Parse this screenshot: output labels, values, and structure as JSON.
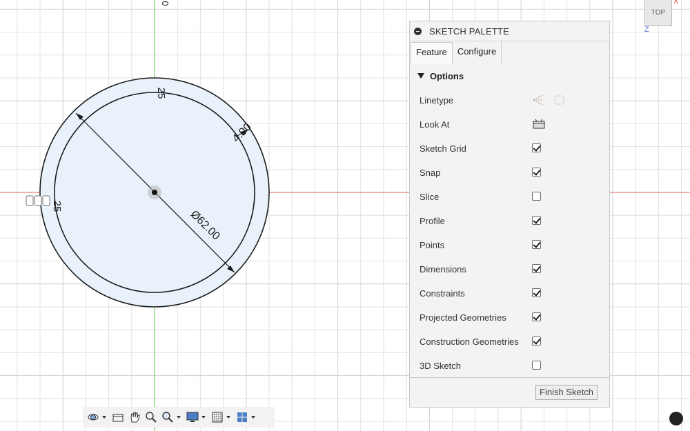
{
  "viewport": {
    "dim_radius": "25",
    "dim_offset": "4.00",
    "dim_diameter": "Ø62.00",
    "origin_label": "0"
  },
  "viewcube": {
    "face": "TOP",
    "axis_x": "X",
    "axis_z": "Z"
  },
  "palette": {
    "title": "SKETCH PALETTE",
    "tabs": [
      {
        "label": "Feature",
        "active": true
      },
      {
        "label": "Configure",
        "active": false
      }
    ],
    "section": "Options",
    "rows": [
      {
        "label": "Linetype",
        "control": "icons",
        "icons": [
          "construction-linetype-icon",
          "centerline-linetype-icon"
        ]
      },
      {
        "label": "Look At",
        "control": "icon",
        "icons": [
          "look-at-icon"
        ]
      },
      {
        "label": "Sketch Grid",
        "control": "checkbox",
        "checked": true
      },
      {
        "label": "Snap",
        "control": "checkbox",
        "checked": true
      },
      {
        "label": "Slice",
        "control": "checkbox",
        "checked": false
      },
      {
        "label": "Profile",
        "control": "checkbox",
        "checked": true
      },
      {
        "label": "Points",
        "control": "checkbox",
        "checked": true
      },
      {
        "label": "Dimensions",
        "control": "checkbox",
        "checked": true
      },
      {
        "label": "Constraints",
        "control": "checkbox",
        "checked": true
      },
      {
        "label": "Projected Geometries",
        "control": "checkbox",
        "checked": true
      },
      {
        "label": "Construction Geometries",
        "control": "checkbox",
        "checked": true
      },
      {
        "label": "3D Sketch",
        "control": "checkbox",
        "checked": false
      }
    ],
    "finish_button": "Finish Sketch"
  },
  "toolbar": {
    "icons": [
      "orbit-icon",
      "look-at-icon",
      "pan-icon",
      "zoom-icon",
      "fit-icon",
      "display-settings-icon",
      "grid-snap-icon",
      "viewports-icon"
    ]
  },
  "colors": {
    "grid_line": "#e2e2e2",
    "x_axis": "#e06060",
    "y_axis": "#59c94b",
    "profile_fill": "#e9f2fb",
    "sketch_line": "#1a1a1a"
  }
}
